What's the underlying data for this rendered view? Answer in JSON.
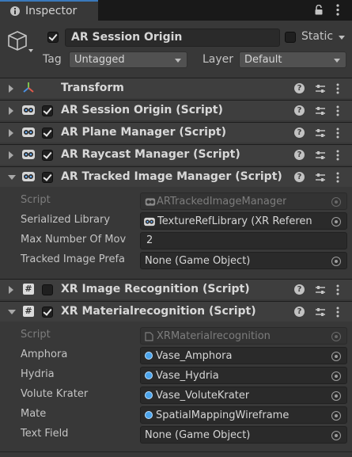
{
  "window": {
    "tab_label": "Inspector",
    "tab_icon": "info-icon",
    "lock_icon": "lock-icon",
    "menu_icon": "kebab-icon"
  },
  "header": {
    "object_name": "AR Session Origin",
    "active": true,
    "static_label": "Static",
    "static_checked": false,
    "tag_label": "Tag",
    "tag_value": "Untagged",
    "layer_label": "Layer",
    "layer_value": "Default"
  },
  "components": [
    {
      "title": "Transform",
      "expanded": false,
      "has_checkbox": false,
      "icon": "transform-axes-icon"
    },
    {
      "title": "AR Session Origin (Script)",
      "expanded": false,
      "has_checkbox": true,
      "enabled": true,
      "icon": "ar-script-icon"
    },
    {
      "title": "AR Plane Manager (Script)",
      "expanded": false,
      "has_checkbox": true,
      "enabled": true,
      "icon": "ar-script-icon"
    },
    {
      "title": "AR Raycast Manager (Script)",
      "expanded": false,
      "has_checkbox": true,
      "enabled": true,
      "icon": "ar-script-icon"
    },
    {
      "title": "AR Tracked Image Manager (Script)",
      "expanded": true,
      "has_checkbox": true,
      "enabled": true,
      "icon": "ar-script-icon"
    },
    {
      "title": "XR Image Recognition (Script)",
      "expanded": false,
      "has_checkbox": true,
      "enabled": false,
      "icon": "csharp-script-icon"
    },
    {
      "title": "XR Materialrecognition (Script)",
      "expanded": true,
      "has_checkbox": true,
      "enabled": true,
      "icon": "csharp-script-icon"
    }
  ],
  "tracked_image_manager": {
    "script_label": "Script",
    "script_value": "ARTrackedImageManager",
    "library_label": "Serialized Library",
    "library_value": "TextureRefLibrary (XR Referen",
    "max_label": "Max Number Of Mov",
    "max_value": "2",
    "prefab_label": "Tracked Image Prefa",
    "prefab_value": "None (Game Object)"
  },
  "material_recognition": {
    "script_label": "Script",
    "script_value": "XRMaterialrecognition",
    "fields": [
      {
        "label": "Amphora",
        "value": "Vase_Amphora"
      },
      {
        "label": "Hydria",
        "value": "Vase_Hydria"
      },
      {
        "label": "Volute Krater",
        "value": "Vase_VoluteKrater"
      },
      {
        "label": "Mate",
        "value": "SpatialMappingWireframe"
      }
    ],
    "text_field_label": "Text Field",
    "text_field_value": "None (Game Object)"
  },
  "colors": {
    "background": "#383838",
    "component_header": "#3e3e3e",
    "tab_accent": "#3a79bb",
    "material_dot": "#4aa3ea"
  }
}
